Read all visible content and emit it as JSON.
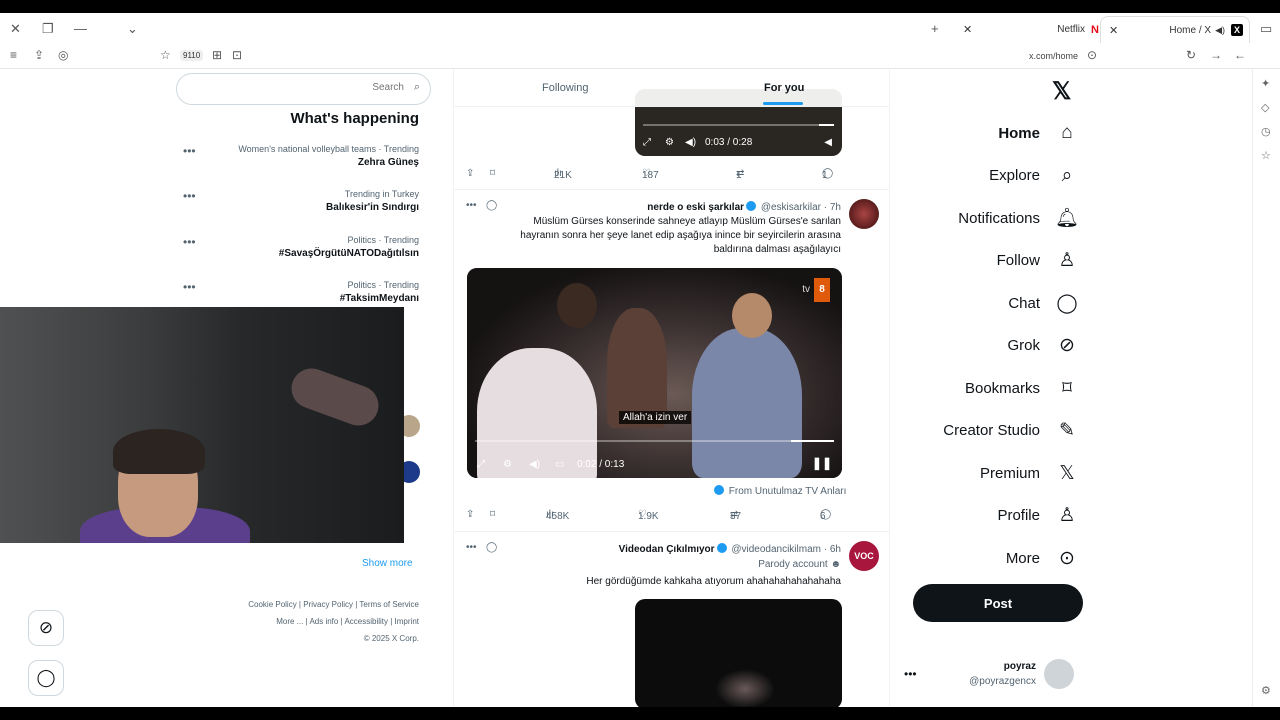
{
  "browser": {
    "tabs": [
      {
        "title": "Home / X"
      },
      {
        "title": "Netflix"
      }
    ],
    "url": "x.com/home",
    "extension_badge": "9110"
  },
  "nav": {
    "items": [
      {
        "label": "Home",
        "icon": "home-icon"
      },
      {
        "label": "Explore",
        "icon": "search-icon"
      },
      {
        "label": "Notifications",
        "icon": "bell-icon"
      },
      {
        "label": "Follow",
        "icon": "person-add-icon"
      },
      {
        "label": "Chat",
        "icon": "chat-icon"
      },
      {
        "label": "Grok",
        "icon": "grok-icon"
      },
      {
        "label": "Bookmarks",
        "icon": "bookmark-icon"
      },
      {
        "label": "Creator Studio",
        "icon": "creator-icon"
      },
      {
        "label": "Premium",
        "icon": "x-premium-icon"
      },
      {
        "label": "Profile",
        "icon": "profile-icon"
      },
      {
        "label": "More",
        "icon": "more-icon"
      }
    ],
    "post_label": "Post",
    "account": {
      "name": "poyraz",
      "handle": "@poyrazgencx"
    }
  },
  "timeline": {
    "tabs": [
      {
        "label": "For you",
        "active": true
      },
      {
        "label": "Following",
        "active": false
      }
    ],
    "first_post": {
      "video_time": "0:03 / 0:28",
      "replies": "1",
      "reposts": "1",
      "likes": "187",
      "views": "21K"
    },
    "second_post": {
      "author": "nerde o eski şarkılar",
      "handle": "@eskisarkilar",
      "time": "7h",
      "text": "Müslüm Gürses konserinde sahneye atlayıp Müslüm Gürses'e sarılan hayranın sonra her şeye lanet edip aşağıya inince bir seyircilerin arasına baldırına dalması aşağılayıcı",
      "caption": "Allah'a izin ver",
      "video_time": "0:02 / 0:13",
      "tv_label": "tv",
      "from_text": "From Unutulmaz TV Anları",
      "replies": "6",
      "reposts": "37",
      "likes": "1.9K",
      "views": "458K"
    },
    "third_post": {
      "author": "Videodan Çıkılmıyor",
      "handle": "@videodancikilmam",
      "time": "6h",
      "badge": "Parody account",
      "text": "Her gördüğümde kahkaha atıyorum ahahahahahahahaha"
    }
  },
  "right_panel": {
    "search_placeholder": "Search",
    "trends_title": "What's happening",
    "trends": [
      {
        "meta": "Women's national volleyball teams · Trending",
        "name": "Zehra Güneş"
      },
      {
        "meta": "Trending in Turkey",
        "name": "Balıkesir'in Sındırgı"
      },
      {
        "meta": "Politics · Trending",
        "name": "#SavaşÖrgütüNATODağıtılsın"
      },
      {
        "meta": "Politics · Trending",
        "name": "#TaksimMeydanı"
      }
    ],
    "show_more": "Show more",
    "footer": [
      "Terms of Service",
      "Privacy Policy",
      "Cookie Policy",
      "Imprint",
      "Accessibility",
      "Ads info",
      "More ...",
      "© 2025 X Corp."
    ]
  }
}
